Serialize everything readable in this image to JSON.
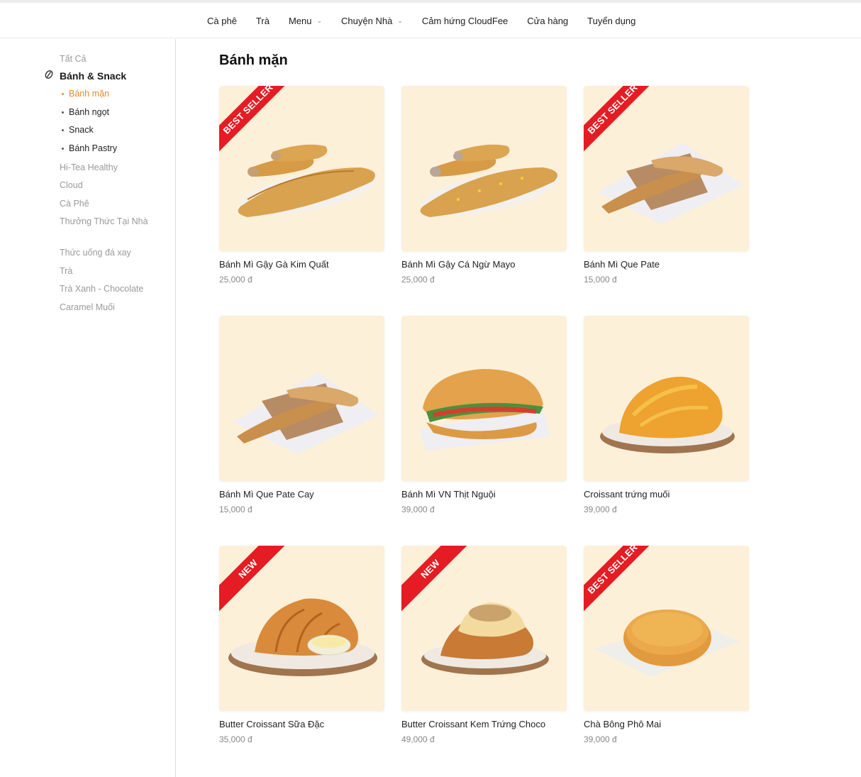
{
  "nav": {
    "items": [
      {
        "label": "Cà phê",
        "dropdown": false
      },
      {
        "label": "Trà",
        "dropdown": false
      },
      {
        "label": "Menu",
        "dropdown": true
      },
      {
        "label": "Chuyện Nhà",
        "dropdown": true
      },
      {
        "label": "Cảm hứng CloudFee",
        "dropdown": false
      },
      {
        "label": "Cửa hàng",
        "dropdown": false
      },
      {
        "label": "Tuyển dụng",
        "dropdown": false
      }
    ]
  },
  "sidebar": {
    "all_label": "Tất Cả",
    "group_label": "Bánh & Snack",
    "group_icon": "coffee-bean-icon",
    "subitems": [
      {
        "label": "Bánh mặn",
        "active": true
      },
      {
        "label": "Bánh ngọt",
        "active": false
      },
      {
        "label": "Snack",
        "active": false
      },
      {
        "label": "Bánh Pastry",
        "active": false
      }
    ],
    "categories": [
      "Hi-Tea Healthy",
      "Cloud",
      "Cà Phê",
      "Thưởng Thức Tại Nhà",
      "Thức uống đá xay",
      "Trà",
      "Trà Xanh - Chocolate",
      "Caramel Muối"
    ]
  },
  "main": {
    "title": "Bánh mặn",
    "products": [
      {
        "name": "Bánh Mì Gậy Gà Kim Quất",
        "price": "25,000 đ",
        "badge": "BEST SELLER",
        "image": "baguette-rolls"
      },
      {
        "name": "Bánh Mì Gậy Cá Ngừ Mayo",
        "price": "25,000 đ",
        "badge": "",
        "image": "baguette-rolls-corn"
      },
      {
        "name": "Bánh Mì Que Pate",
        "price": "15,000 đ",
        "badge": "BEST SELLER",
        "image": "wrapped-bread"
      },
      {
        "name": "Bánh Mì Que Pate Cay",
        "price": "15,000 đ",
        "badge": "",
        "image": "wrapped-bread"
      },
      {
        "name": "Bánh Mì VN Thịt Nguội",
        "price": "39,000 đ",
        "badge": "",
        "image": "banh-mi-sandwich"
      },
      {
        "name": "Croissant trứng muối",
        "price": "39,000 đ",
        "badge": "",
        "image": "croissant-floss"
      },
      {
        "name": "Butter Croissant Sữa Đặc",
        "price": "35,000 đ",
        "badge": "NEW",
        "image": "croissant-milk"
      },
      {
        "name": "Butter Croissant Kem Trứng Choco",
        "price": "49,000 đ",
        "badge": "NEW",
        "image": "croissant-cream"
      },
      {
        "name": "Chà Bông Phô Mai",
        "price": "39,000 đ",
        "badge": "BEST SELLER",
        "image": "floss-bun"
      }
    ]
  },
  "colors": {
    "accent": "#e88a2e",
    "ribbon": "#e51c23",
    "card_bg": "#fdf0d9"
  }
}
